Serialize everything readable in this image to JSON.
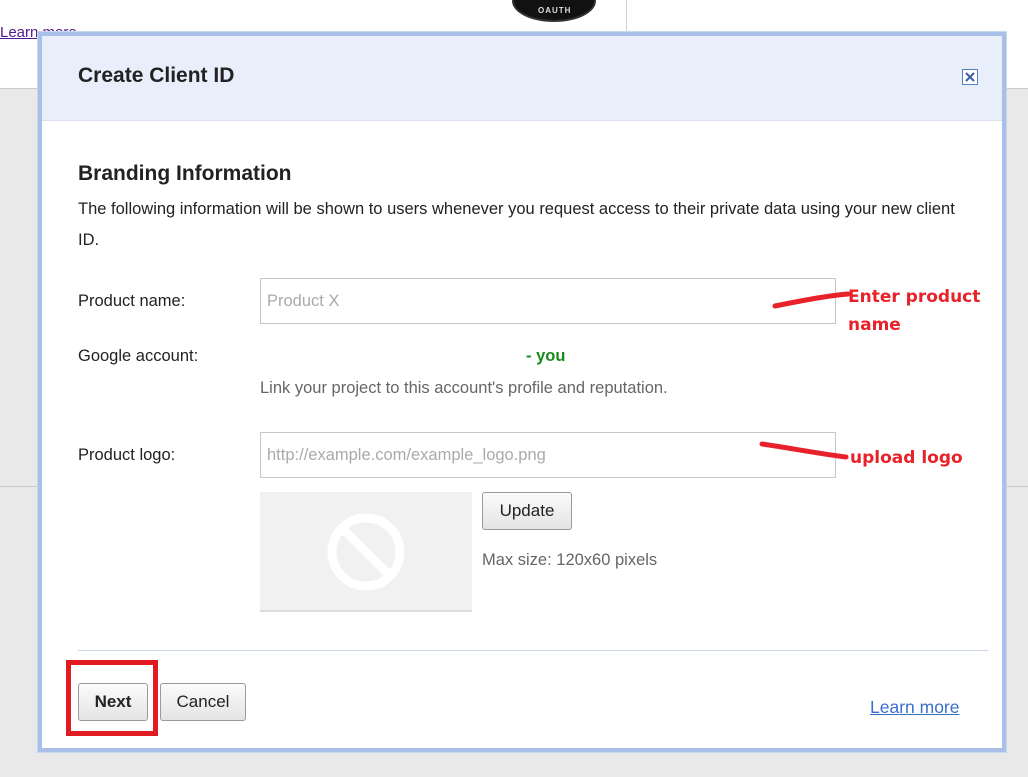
{
  "background": {
    "link_text": "Learn more"
  },
  "dialog": {
    "title": "Create Client ID",
    "close_label": "×",
    "section_title": "Branding Information",
    "description": "The following information will be shown to users whenever you request access to their private data using your new client ID.",
    "product_name": {
      "label": "Product name:",
      "placeholder": "Product X"
    },
    "google_account": {
      "label": "Google account:",
      "value": "- you",
      "helper": "Link your project to this account's profile and reputation."
    },
    "product_logo": {
      "label": "Product logo:",
      "placeholder": "http://example.com/example_logo.png"
    },
    "update_button": "Update",
    "max_size": "Max size: 120x60 pixels",
    "next_button": "Next",
    "cancel_button": "Cancel",
    "learn_more": "Learn more"
  },
  "annotations": {
    "enter_product_name": "Enter product name",
    "upload_logo": "upload logo",
    "color": "#e8222a"
  },
  "colors": {
    "header_bg": "#e8eefa",
    "dialog_border": "#a8c0e8",
    "link": "#3b6ec9",
    "account_green": "#1a8a1a"
  }
}
